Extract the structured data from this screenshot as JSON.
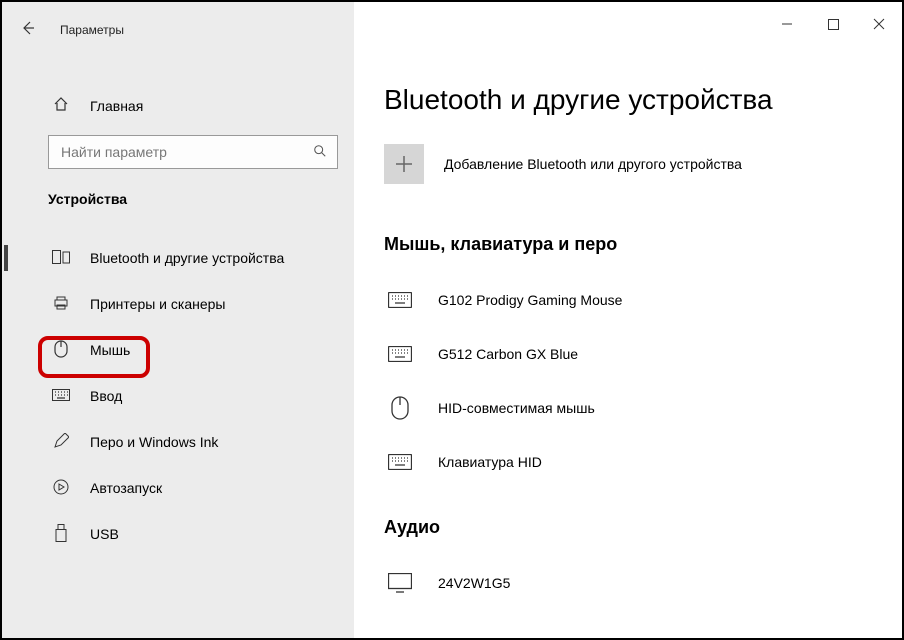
{
  "window": {
    "title": "Параметры"
  },
  "home_label": "Главная",
  "search": {
    "placeholder": "Найти параметр"
  },
  "category_label": "Устройства",
  "nav": {
    "bluetooth": "Bluetooth и другие устройства",
    "printers": "Принтеры и сканеры",
    "mouse": "Мышь",
    "typing": "Ввод",
    "pen": "Перо и Windows Ink",
    "autoplay": "Автозапуск",
    "usb": "USB"
  },
  "page": {
    "title": "Bluetooth и другие устройства",
    "add_label": "Добавление Bluetooth или другого устройства",
    "section1": "Мышь, клавиатура и перо",
    "devices": {
      "d1": "G102 Prodigy Gaming Mouse",
      "d2": "G512 Carbon GX Blue",
      "d3": "HID-совместимая мышь",
      "d4": "Клавиатура HID"
    },
    "section2": "Аудио",
    "audio1": "24V2W1G5"
  }
}
